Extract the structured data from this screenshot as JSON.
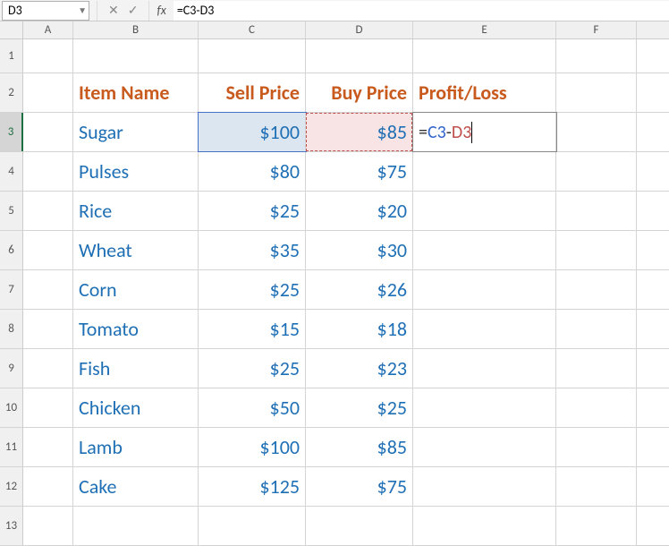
{
  "nameBox": "D3",
  "formulaBar": {
    "cancel": "✕",
    "confirm": "✓",
    "fx": "fx",
    "formula": "=C3-D3"
  },
  "columns": [
    "A",
    "B",
    "C",
    "D",
    "E",
    "F"
  ],
  "headers": {
    "B": "Item Name",
    "C": "Sell Price",
    "D": "Buy Price",
    "E": "Profit/Loss"
  },
  "editingFormula": {
    "prefix": "=",
    "ref1": "C3",
    "op": "-",
    "ref2": "D3"
  },
  "rows": [
    {
      "n": 1
    },
    {
      "n": 2
    },
    {
      "n": 3,
      "B": "Sugar",
      "C": "$100",
      "D": "$85"
    },
    {
      "n": 4,
      "B": "Pulses",
      "C": "$80",
      "D": "$75"
    },
    {
      "n": 5,
      "B": "Rice",
      "C": "$25",
      "D": "$20"
    },
    {
      "n": 6,
      "B": "Wheat",
      "C": "$35",
      "D": "$30"
    },
    {
      "n": 7,
      "B": "Corn",
      "C": "$25",
      "D": "$26"
    },
    {
      "n": 8,
      "B": "Tomato",
      "C": "$15",
      "D": "$18"
    },
    {
      "n": 9,
      "B": "Fish",
      "C": "$25",
      "D": "$23"
    },
    {
      "n": 10,
      "B": "Chicken",
      "C": "$50",
      "D": "$25"
    },
    {
      "n": 11,
      "B": "Lamb",
      "C": "$100",
      "D": "$85"
    },
    {
      "n": 12,
      "B": "Cake",
      "C": "$125",
      "D": "$75"
    },
    {
      "n": 13
    }
  ],
  "chart_data": {
    "type": "table",
    "columns": [
      "Item Name",
      "Sell Price",
      "Buy Price",
      "Profit/Loss"
    ],
    "data": [
      [
        "Sugar",
        100,
        85,
        null
      ],
      [
        "Pulses",
        80,
        75,
        null
      ],
      [
        "Rice",
        25,
        20,
        null
      ],
      [
        "Wheat",
        35,
        30,
        null
      ],
      [
        "Corn",
        25,
        26,
        null
      ],
      [
        "Tomato",
        15,
        18,
        null
      ],
      [
        "Fish",
        25,
        23,
        null
      ],
      [
        "Chicken",
        50,
        25,
        null
      ],
      [
        "Lamb",
        100,
        85,
        null
      ],
      [
        "Cake",
        125,
        75,
        null
      ]
    ]
  }
}
